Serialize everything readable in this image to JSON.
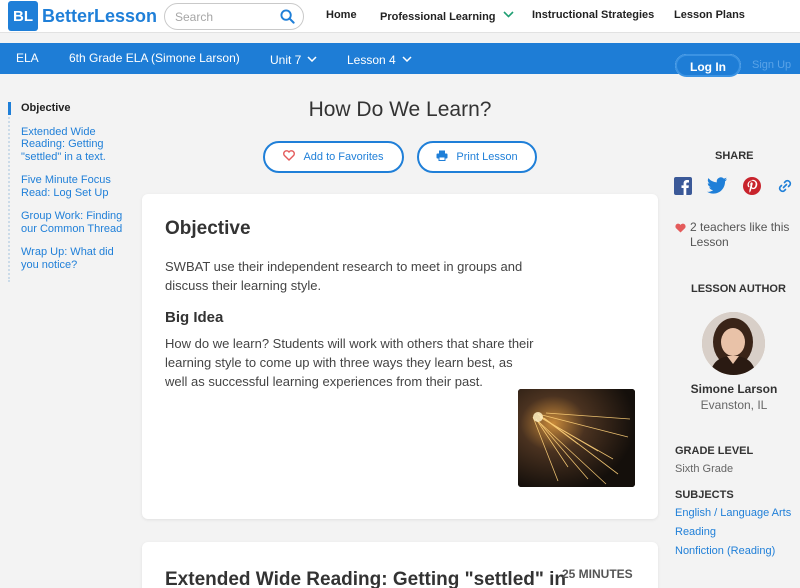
{
  "header": {
    "logo_mark": "BL",
    "logo_text": "BetterLesson",
    "search_placeholder": "Search",
    "nav": [
      "Home",
      "Professional Learning",
      "Instructional Strategies",
      "Lesson Plans"
    ]
  },
  "subbar": {
    "subject": "ELA",
    "course": "6th Grade ELA (Simone Larson)",
    "unit": "Unit 7",
    "lesson": "Lesson 4",
    "login": "Log In",
    "signup": "Sign Up"
  },
  "sidenav": [
    "Objective",
    "Extended Wide Reading: Getting \"settled\" in a text.",
    "Five Minute Focus Read: Log Set Up",
    "Group Work: Finding our Common Thread",
    "Wrap Up: What did you notice?"
  ],
  "lesson": {
    "title": "How Do We Learn?",
    "favorites_label": "Add to Favorites",
    "print_label": "Print Lesson",
    "objective_heading": "Objective",
    "objective_text": "SWBAT use their independent research to meet in groups and discuss their learning style.",
    "bigidea_heading": "Big Idea",
    "bigidea_text": "How do we learn? Students will work with others that share their learning style to come up with three ways they learn best, as well as successful learning experiences from their past.",
    "next_section_title": "Extended Wide Reading: Getting \"settled\" in",
    "next_section_minutes": "25 MINUTES"
  },
  "sidebar_right": {
    "share_label": "SHARE",
    "likes_text": "2 teachers like this Lesson",
    "author_label": "LESSON AUTHOR",
    "author_name": "Simone Larson",
    "author_location": "Evanston, IL",
    "grade_label": "GRADE LEVEL",
    "grade_value": "Sixth Grade",
    "subjects_label": "SUBJECTS",
    "subjects": [
      "English / Language Arts",
      "Reading",
      "Nonfiction (Reading)"
    ]
  },
  "icons": {
    "share": [
      "facebook-icon",
      "twitter-icon",
      "pinterest-icon",
      "link-icon"
    ],
    "favorite": "heart-icon",
    "print": "printer-icon",
    "search": "search-icon"
  },
  "colors": {
    "brand_blue": "#1f7fd8",
    "subbar_blue": "#1e7dd6",
    "heart_red": "#e45b5b",
    "page_bg": "#f3f3f3"
  }
}
